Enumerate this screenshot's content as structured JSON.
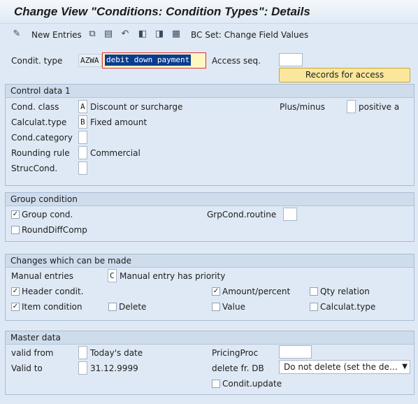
{
  "title": "Change View \"Conditions: Condition Types\": Details",
  "toolbar": {
    "new_entries": "New Entries",
    "bc_set": "BC Set: Change Field Values",
    "icons": [
      "pencil-icon",
      "copy-icon",
      "delete-icon",
      "undo-icon",
      "previous-entry-icon",
      "next-entry-icon",
      "select-icon"
    ]
  },
  "header": {
    "condit_type_label": "Condit. type",
    "condit_type_code": "AZWA",
    "condit_type_desc": "debit down payment",
    "access_seq_label": "Access seq.",
    "access_seq_value": "",
    "records_button": "Records for access"
  },
  "control": {
    "title": "Control data 1",
    "cond_class_label": "Cond. class",
    "cond_class_value": "A",
    "cond_class_text": "Discount or surcharge",
    "plus_minus_label": "Plus/minus",
    "plus_minus_value": "",
    "plus_minus_text": "positive a",
    "calc_type_label": "Calculat.type",
    "calc_type_value": "B",
    "calc_type_text": "Fixed amount",
    "cond_cat_label": "Cond.category",
    "cond_cat_value": "",
    "rounding_label": "Rounding rule",
    "rounding_value": "",
    "rounding_text": "Commercial",
    "struc_label": "StrucCond.",
    "struc_value": ""
  },
  "group": {
    "title": "Group condition",
    "group_cond_label": "Group cond.",
    "group_cond_checked": true,
    "routine_label": "GrpCond.routine",
    "routine_value": "",
    "round_diff_label": "RoundDiffComp",
    "round_diff_checked": false
  },
  "changes": {
    "title": "Changes which can be made",
    "manual_label": "Manual entries",
    "manual_value": "C",
    "manual_text": "Manual entry has priority",
    "header_cond_label": "Header condit.",
    "header_cond_checked": true,
    "amount_label": "Amount/percent",
    "amount_checked": true,
    "qty_label": "Qty relation",
    "qty_checked": false,
    "item_cond_label": "Item condition",
    "item_cond_checked": true,
    "delete_label": "Delete",
    "delete_checked": false,
    "value_label": "Value",
    "value_checked": false,
    "calc_type_label": "Calculat.type",
    "calc_type_checked": false
  },
  "master": {
    "title": "Master data",
    "valid_from_label": "valid from",
    "valid_from_value": "",
    "valid_from_text": "Today's date",
    "valid_to_label": "Valid to",
    "valid_to_value": "",
    "valid_to_text": "31.12.9999",
    "pricing_label": "PricingProc",
    "pricing_value": "",
    "delete_db_label": "delete fr. DB",
    "delete_db_value": "Do not delete (set the delet...",
    "condit_update_label": "Condit.update",
    "condit_update_checked": false
  }
}
